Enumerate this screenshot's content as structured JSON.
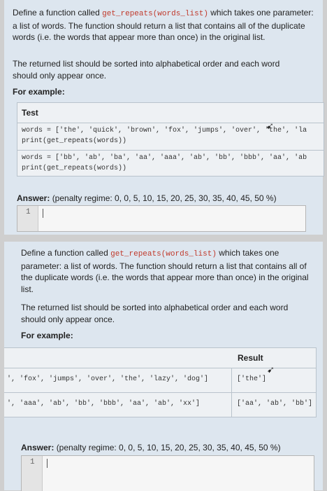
{
  "q1": {
    "desc_before": "Define a function called ",
    "func": "get_repeats(words_list)",
    "desc_after": " which takes one parameter: a list of words. The function should return a list that contains all of the duplicate words (i.e. the words that appear more than once) in the original list.",
    "note": "The returned list should be sorted into alphabetical order and each word should only appear once.",
    "example_label": "For example:",
    "test_header": "Test",
    "tests": [
      {
        "line1": "words = ['the', 'quick', 'brown', 'fox', 'jumps', 'over', 'the', 'la",
        "line2": "print(get_repeats(words))"
      },
      {
        "line1": "words = ['bb', 'ab', 'ba', 'aa', 'aaa', 'ab', 'bb', 'bbb', 'aa', 'ab",
        "line2": "print(get_repeats(words))"
      }
    ],
    "answer_label": "Answer:",
    "penalty": "(penalty regime: 0, 0, 5, 10, 15, 20, 25, 30, 35, 40, 45, 50 %)",
    "line_number": "1"
  },
  "q2": {
    "desc_before": "Define a function called ",
    "func": "get_repeats(words_list)",
    "desc_after": " which takes one parameter: a list of words. The function should return a list that contains all of the duplicate words (i.e. the words that appear more than once) in the original list.",
    "note": "The returned list should be sorted into alphabetical order and each word should only appear once.",
    "example_label": "For example:",
    "result_header": "Result",
    "rows": [
      {
        "code": "', 'fox', 'jumps', 'over', 'the', 'lazy', 'dog']",
        "result": "['the']"
      },
      {
        "code": "', 'aaa', 'ab', 'bb', 'bbb', 'aa', 'ab', 'xx']",
        "result": "['aa', 'ab', 'bb']"
      }
    ],
    "answer_label": "Answer:",
    "penalty": "(penalty regime: 0, 0, 5, 10, 15, 20, 25, 30, 35, 40, 45, 50 %)",
    "line_number": "1"
  }
}
